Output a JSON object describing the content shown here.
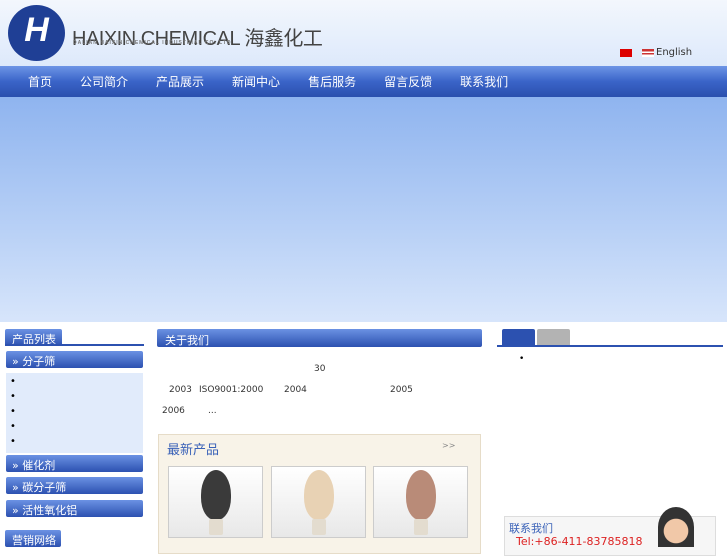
{
  "header": {
    "logo_letters": "H",
    "brand": "HAIXIN CHEMICAL 海鑫化工",
    "brand_sub": "DALIAN HAIXIN CHEMICAL INDUSTRIAL CO.,LTD",
    "lang_english": "English"
  },
  "nav": [
    "首页",
    "公司简介",
    "产品展示",
    "新闻中心",
    "售后服务",
    "留言反馈",
    "联系我们"
  ],
  "sidebar": {
    "title": "产品列表",
    "categories": [
      "分子筛",
      "催化剂",
      "碳分子筛",
      "活性氧化铝"
    ],
    "market_title": "营销网络"
  },
  "about": {
    "title": "关于我们",
    "fragments": [
      "30",
      "2003",
      "ISO9001:2000",
      "2004",
      "2005",
      "2006",
      "..."
    ]
  },
  "newest": {
    "title": "最新产品",
    "more": ">>"
  },
  "contact": {
    "title": "联系我们",
    "tel": "Tel:+86-411-83785818"
  }
}
